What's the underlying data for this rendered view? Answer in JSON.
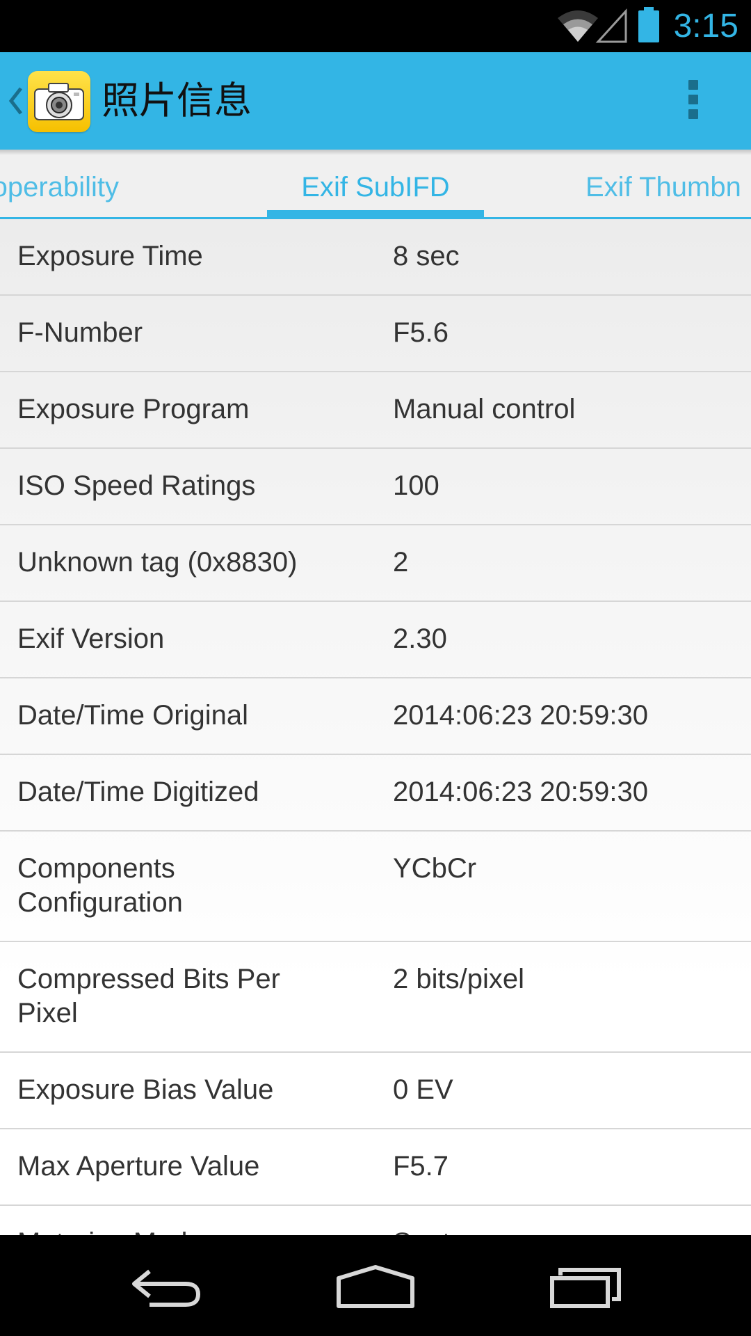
{
  "status_bar": {
    "time": "3:15",
    "icons": [
      "wifi-icon",
      "cell-signal-icon",
      "battery-icon"
    ]
  },
  "action_bar": {
    "title": "照片信息",
    "app_icon": "camera-app-icon",
    "overflow_icon": "overflow-menu-icon",
    "color": "#33b5e5"
  },
  "tabs": {
    "items": [
      {
        "label": "Interoperability"
      },
      {
        "label": "Exif SubIFD"
      },
      {
        "label": "Exif Thumbnail"
      }
    ],
    "visible_prev": "teroperability",
    "visible_next": "Exif Thumbn",
    "selected": "Exif SubIFD"
  },
  "rows": [
    {
      "label": "Exposure Time",
      "value": "8 sec"
    },
    {
      "label": "F-Number",
      "value": "F5.6"
    },
    {
      "label": "Exposure Program",
      "value": "Manual control"
    },
    {
      "label": "ISO Speed Ratings",
      "value": "100"
    },
    {
      "label": "Unknown tag (0x8830)",
      "value": "2"
    },
    {
      "label": "Exif Version",
      "value": "2.30"
    },
    {
      "label": "Date/Time Original",
      "value": "2014:06:23 20:59:30"
    },
    {
      "label": "Date/Time Digitized",
      "value": "2014:06:23 20:59:30"
    },
    {
      "label": "Components Configuration",
      "value": "YCbCr"
    },
    {
      "label": "Compressed Bits Per Pixel",
      "value": "2 bits/pixel"
    },
    {
      "label": "Exposure Bias Value",
      "value": "0 EV"
    },
    {
      "label": "Max Aperture Value",
      "value": "F5.7"
    },
    {
      "label": "Metering Mode",
      "value": "Spot"
    }
  ],
  "nav_bar": {
    "icons": [
      "back-icon",
      "home-icon",
      "recents-icon"
    ]
  }
}
